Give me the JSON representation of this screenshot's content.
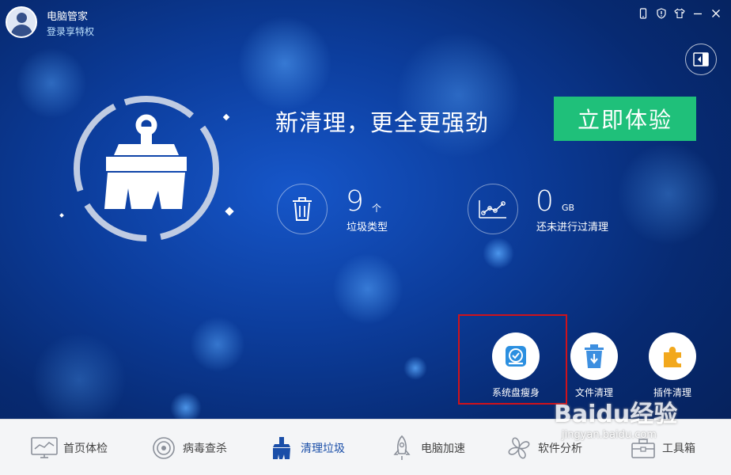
{
  "app": {
    "name": "电脑管家",
    "login_link": "登录享特权"
  },
  "window_controls": [
    {
      "name": "phone-icon"
    },
    {
      "name": "shield-icon"
    },
    {
      "name": "shirt-icon"
    },
    {
      "name": "minimize-icon"
    },
    {
      "name": "close-icon"
    }
  ],
  "hero": {
    "headline": "新清理，更全更强劲",
    "cta_label": "立即体验"
  },
  "stats": {
    "junk": {
      "value": "9",
      "unit": "个",
      "label": "垃圾类型",
      "icon": "trash-icon"
    },
    "space": {
      "value": "0",
      "unit": "GB",
      "label": "还未进行过清理",
      "icon": "line-chart-icon"
    }
  },
  "tools": [
    {
      "label": "系统盘瘦身",
      "icon": "disk-check-icon"
    },
    {
      "label": "文件清理",
      "icon": "file-trash-icon"
    },
    {
      "label": "插件清理",
      "icon": "puzzle-icon"
    }
  ],
  "nav": [
    {
      "label": "首页体检",
      "icon": "monitor-chart-icon"
    },
    {
      "label": "病毒查杀",
      "icon": "target-icon"
    },
    {
      "label": "清理垃圾",
      "icon": "broom-icon"
    },
    {
      "label": "电脑加速",
      "icon": "rocket-icon"
    },
    {
      "label": "软件分析",
      "icon": "fan-icon"
    },
    {
      "label": "工具箱",
      "icon": "toolbox-icon"
    }
  ],
  "watermark": {
    "brand": "Baidu经验",
    "url": "jingyan.baidu.com"
  },
  "colors": {
    "accent_green": "#1fc07a",
    "background_blue": "#0c3d9c",
    "highlight_red": "#d0121b",
    "active_nav": "#1a4ea8"
  }
}
